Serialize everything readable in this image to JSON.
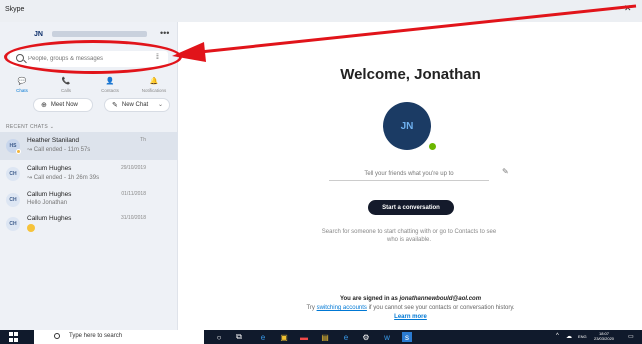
{
  "window": {
    "title": "Skype"
  },
  "controls": {
    "minimize": "–",
    "close": "✕"
  },
  "sidebar": {
    "profile_initials": "JN",
    "more": "•••",
    "search_placeholder": "People, groups & messages",
    "dial_icon": "⁞⁞",
    "nav": [
      {
        "icon": "💬",
        "label": "Chats"
      },
      {
        "icon": "📞",
        "label": "Calls"
      },
      {
        "icon": "👤",
        "label": "Contacts"
      },
      {
        "icon": "🔔",
        "label": "Notifications"
      }
    ],
    "meet_now": "Meet Now",
    "new_chat": "New Chat",
    "recent_label": "RECENT CHATS",
    "chats": [
      {
        "initials": "HS",
        "name": "Heather Staniland",
        "sub": "Call ended - 11m 57s",
        "time": "Th"
      },
      {
        "initials": "CH",
        "name": "Callum Hughes",
        "sub": "Call ended - 1h 26m 39s",
        "time": "29/10/2019"
      },
      {
        "initials": "CH",
        "name": "Callum Hughes",
        "sub": "Hello Jonathan",
        "time": "01/11/2018"
      },
      {
        "initials": "CH",
        "name": "Callum Hughes",
        "sub": "",
        "time": "31/10/2018"
      }
    ]
  },
  "main": {
    "welcome": "Welcome, Jonathan",
    "avatar_initials": "JN",
    "mood_placeholder": "Tell your friends what you're up to",
    "start_button": "Start a conversation",
    "hint": "Search for someone to start chatting with or go to Contacts to see who is available.",
    "signed_in_prefix": "You are signed in as",
    "email": "jonathannewbould@aol.com",
    "try": "Try",
    "switching": "switching accounts",
    "switch_suffix": "if you cannot see your contacts or conversation history.",
    "learn_more": "Learn more"
  },
  "taskbar": {
    "search_text": "Type here to search",
    "language": "ENG",
    "time": "18:07",
    "date": "23/03/2020"
  },
  "colors": {
    "accent": "#0078d4",
    "annotation": "#e1141a",
    "taskbar": "#101a2c"
  }
}
